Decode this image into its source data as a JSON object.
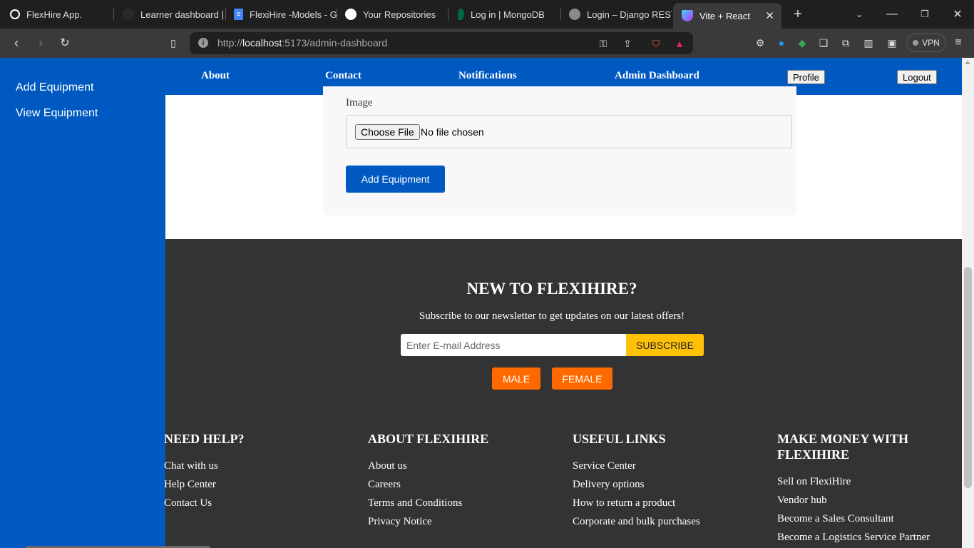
{
  "browser": {
    "tabs": [
      {
        "title": "FlexHire App.",
        "icon": "chatgpt-icon",
        "color": "#ffffff"
      },
      {
        "title": "Learner dashboard | I",
        "icon": "dashboard-icon",
        "color": "#2a2a2a"
      },
      {
        "title": "FlexiHire -Models - G",
        "icon": "docs-icon",
        "color": "#4285f4"
      },
      {
        "title": "Your Repositories",
        "icon": "github-icon",
        "color": "#ffffff"
      },
      {
        "title": "Log in | MongoDB",
        "icon": "mongodb-leaf-icon",
        "color": "#00684a"
      },
      {
        "title": "Login – Django REST",
        "icon": "globe-icon",
        "color": "#8a8a8a"
      },
      {
        "title": "Vite + React",
        "icon": "vite-icon",
        "color": "#8b5cf6"
      }
    ],
    "url_prefix": "http://",
    "url_host": "localhost",
    "url_rest": ":5173/admin-dashboard",
    "vpn_label": "VPN"
  },
  "sidebar": {
    "items": [
      {
        "label": "Add Equipment"
      },
      {
        "label": "View Equipment"
      }
    ]
  },
  "header": {
    "nav": [
      {
        "label": "About"
      },
      {
        "label": "Contact"
      },
      {
        "label": "Notifications"
      },
      {
        "label": "Admin Dashboard"
      }
    ],
    "profile_label": "Profile",
    "logout_label": "Logout"
  },
  "form": {
    "image_label": "Image",
    "file_button": "Choose File",
    "file_status": "No file chosen",
    "submit_label": "Add Equipment"
  },
  "footer": {
    "newsletter_title": "NEW TO FLEXIHIRE?",
    "newsletter_subtitle": "Subscribe to our newsletter to get updates on our latest offers!",
    "email_placeholder": "Enter E-mail Address",
    "subscribe_label": "SUBSCRIBE",
    "male_label": "MALE",
    "female_label": "FEMALE",
    "columns": [
      {
        "title": "NEED HELP?",
        "links": [
          "Chat with us",
          "Help Center",
          "Contact Us"
        ]
      },
      {
        "title": "ABOUT FLEXIHIRE",
        "links": [
          "About us",
          "Careers",
          "Terms and Conditions",
          "Privacy Notice"
        ]
      },
      {
        "title": "USEFUL LINKS",
        "links": [
          "Service Center",
          "Delivery options",
          "How to return a product",
          "Corporate and bulk purchases"
        ]
      },
      {
        "title": "MAKE MONEY WITH FLEXIHIRE",
        "links": [
          "Sell on FlexiHire",
          "Vendor hub",
          "Become a Sales Consultant",
          "Become a Logistics Service Partner"
        ]
      }
    ]
  },
  "colors": {
    "brand_blue": "#0059c1",
    "footer_bg": "#333333",
    "subscribe_yellow": "#ffc107",
    "gender_orange": "#ff6a00"
  }
}
